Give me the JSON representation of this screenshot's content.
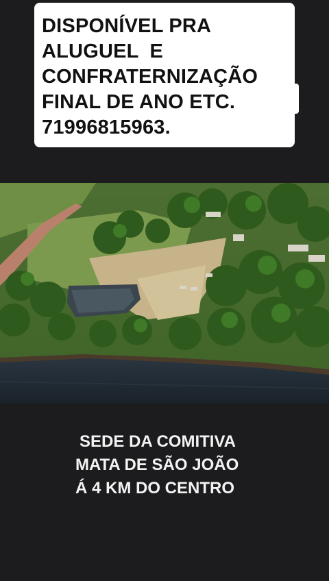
{
  "story": {
    "top_caption": {
      "lines": [
        "DISPONÍVEL PRA",
        "ALUGUEL  E",
        "CONFRATERNIZAÇÃO",
        "FINAL DE ANO ETC.",
        "71996815963."
      ]
    },
    "photo": {
      "subject": "aerial-view-farm-with-pond-and-river"
    },
    "bottom_caption": {
      "lines": [
        "SEDE DA COMITIVA",
        "MATA DE SÃO JOÃO",
        "Á 4 KM DO CENTRO"
      ]
    }
  }
}
